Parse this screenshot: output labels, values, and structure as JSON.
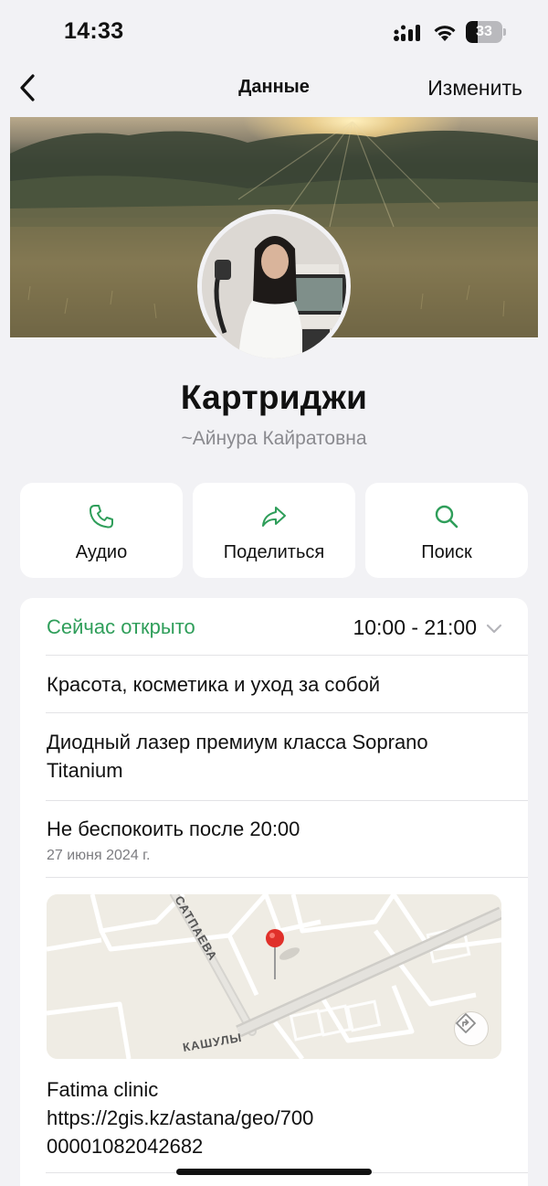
{
  "status_bar": {
    "time": "14:33",
    "battery": "33",
    "battery_level": 0.33
  },
  "nav": {
    "title": "Данные",
    "edit_label": "Изменить"
  },
  "profile": {
    "name": "Картриджи",
    "subtitle": "~Айнура Кайратовна"
  },
  "actions": [
    {
      "label": "Аудио",
      "icon": "phone-icon"
    },
    {
      "label": "Поделиться",
      "icon": "share-arrow-icon"
    },
    {
      "label": "Поиск",
      "icon": "search-icon"
    }
  ],
  "info": {
    "open_status": "Сейчас открыто",
    "hours": "10:00 - 21:00",
    "category": "Красота, косметика и уход за собой",
    "description": "Диодный лазер премиум класса Soprano Titanium",
    "dnd_label": "Не беспокоить после 20:00",
    "dnd_date": "27 июня 2024 г.",
    "map": {
      "street_1": "САТПАЕВА",
      "street_2": "КАШУЛЫ"
    },
    "link_name": "Fatima clinic",
    "link_url": "https://2gis.kz/astana/geo/70000001082042682"
  },
  "colors": {
    "accent_green": "#2f9e5a",
    "background": "#f2f2f5",
    "card": "#ffffff"
  }
}
